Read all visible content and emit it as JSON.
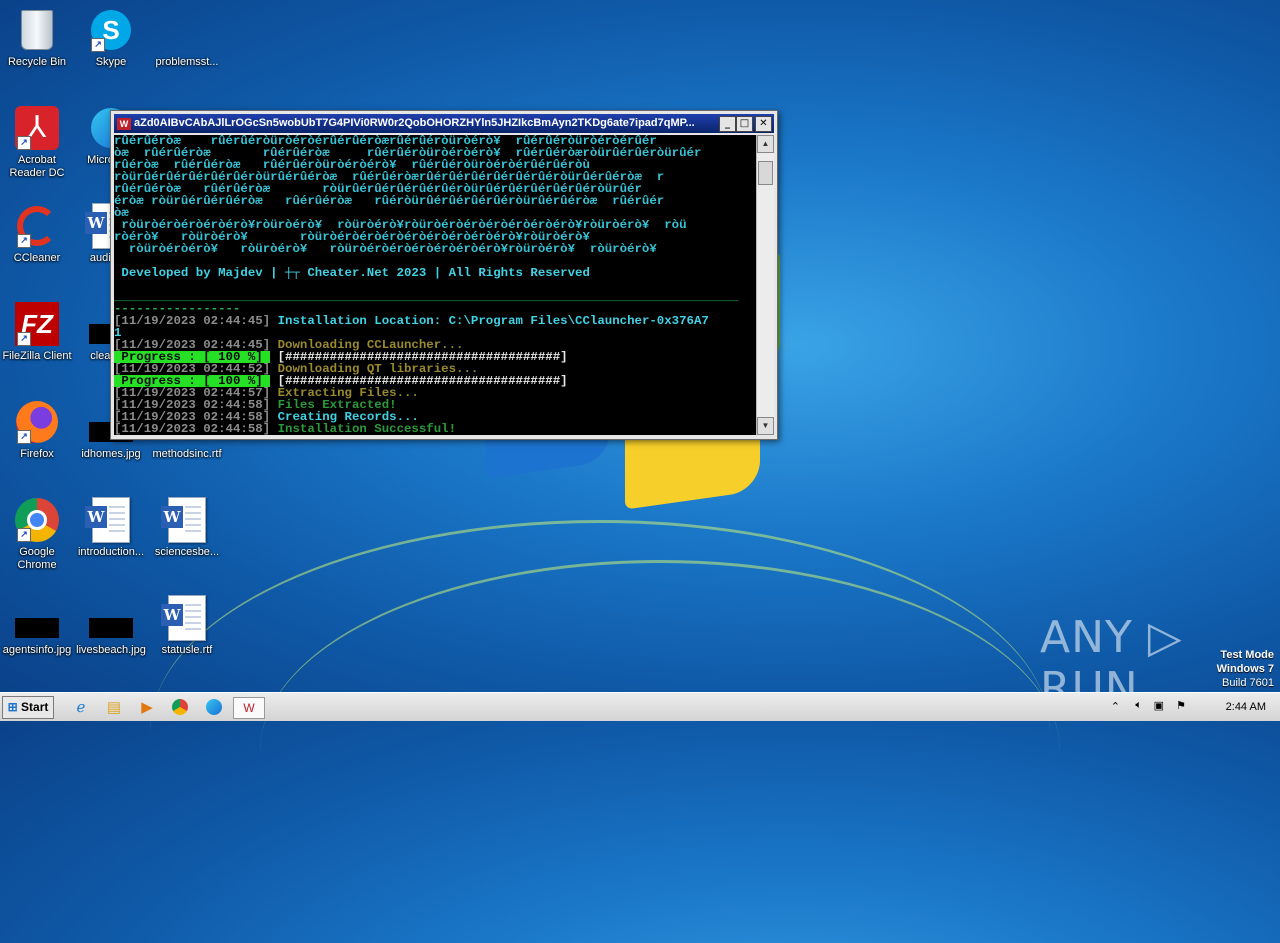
{
  "desktop": {
    "icons": [
      {
        "id": "recycle-bin",
        "label": "Recycle Bin",
        "icon": "recycle-bin-icon"
      },
      {
        "id": "skype",
        "label": "Skype",
        "icon": "skype-icon"
      },
      {
        "id": "problems",
        "label": "problemsst..."
      },
      {
        "id": "acrobat",
        "label": "Acrobat Reader DC"
      },
      {
        "id": "microsoft",
        "label": "Microso..."
      },
      {
        "id": "ccleaner",
        "label": "CCleaner"
      },
      {
        "id": "audiop",
        "label": "audiop..."
      },
      {
        "id": "filezilla",
        "label": "FileZilla Client"
      },
      {
        "id": "cleang",
        "label": "cleang..."
      },
      {
        "id": "firefox",
        "label": "Firefox"
      },
      {
        "id": "idhomes",
        "label": "idhomes.jpg"
      },
      {
        "id": "methodsinc",
        "label": "methodsinc.rtf"
      },
      {
        "id": "chrome",
        "label": "Google Chrome"
      },
      {
        "id": "introduction",
        "label": "introduction..."
      },
      {
        "id": "sciencesbe",
        "label": "sciencesbe..."
      },
      {
        "id": "agentsinfo",
        "label": "agentsinfo.jpg"
      },
      {
        "id": "livesbeach",
        "label": "livesbeach.jpg"
      },
      {
        "id": "statusle",
        "label": "statusle.rtf"
      }
    ]
  },
  "console_window": {
    "title": "aZd0AIBvCAbAJlLrOGcSn5wobUbT7G4PIVi0RW0r2QobOHORZHYln5JHZIkcBmAyn2TKDg6ate7ipad7qMP...",
    "minimize": "_",
    "maximize": "□",
    "close": "✕",
    "lines": [
      {
        "cls": "art",
        "text": "rûérûéròæ    rûérûéròüròéròérûérûéròærûérûéròüròérò¥  rûérûéròüròéròérûér"
      },
      {
        "cls": "art",
        "text": "òæ  rûérûéròæ       rûérûéròæ     rûérûéròüròéròérò¥  rûérûéròæròürûérûéròürûér"
      },
      {
        "cls": "art",
        "text": "rûéròæ  rûérûéròæ   rûérûéròüròéròérò¥  rûérûéròüròéròérûérûéròù"
      },
      {
        "cls": "art",
        "text": "ròürûérûérûérûérûéròürûérûéròæ  rûérûéròærûérûérûérûérûérûéròürûérûéròæ  r"
      },
      {
        "cls": "art",
        "text": "rûérûéròæ   rûérûéròæ       ròürûérûérûérûérûéròürûérûérûérûérûéròürûér"
      },
      {
        "cls": "art",
        "text": "éròæ ròürûérûérûéròæ   rûérûéròæ   rûéròürûérûérûérûéròürûérûéròæ  rûérûér"
      },
      {
        "cls": "art",
        "text": "òæ"
      },
      {
        "cls": "art",
        "text": " ròüròéròéròéròérò¥ròüròérò¥  ròüròérò¥ròüròéròéròéròéròéròérò¥ròüròérò¥  ròü"
      },
      {
        "cls": "art",
        "text": "ròérò¥   ròüròérò¥       ròüròéròéròéròéròéròéròéròérò¥ròüròérò¥"
      },
      {
        "cls": "art",
        "text": "  ròüròéròérò¥   ròüròérò¥   ròüròéròéròéròéròéròérò¥ròüròérò¥  ròüròérò¥"
      },
      {
        "cls": "art",
        "text": ""
      },
      {
        "cls": "cyan",
        "text": " Developed by Majdev | ┼┬ Cheater.Net 2023 | All Rights Reserved"
      },
      {
        "cls": "art",
        "text": ""
      },
      {
        "cls": "sep",
        "text": "____________________________________________________________________________________"
      },
      {
        "cls": "sep",
        "text": "-----------------"
      },
      {
        "cls": "mix",
        "parts": [
          {
            "cls": "gray",
            "text": "[11/19/2023 02:44:45] "
          },
          {
            "cls": "cyan",
            "text": "Installation Location: C:\\Program Files\\CClauncher-0x376A7"
          }
        ]
      },
      {
        "cls": "cyan",
        "text": "1"
      },
      {
        "cls": "mix",
        "parts": [
          {
            "cls": "gray",
            "text": "[11/19/2023 02:44:45] "
          },
          {
            "cls": "olive",
            "text": "Downloading CCLauncher..."
          }
        ]
      },
      {
        "cls": "mix",
        "parts": [
          {
            "cls": "pbar",
            "text": " Progress : [ 100 %] "
          },
          {
            "cls": "white",
            "text": " [#####################################]"
          }
        ]
      },
      {
        "cls": "mix",
        "parts": [
          {
            "cls": "gray",
            "text": "[11/19/2023 02:44:52] "
          },
          {
            "cls": "olive",
            "text": "Downloading QT libraries..."
          }
        ]
      },
      {
        "cls": "mix",
        "parts": [
          {
            "cls": "pbar",
            "text": " Progress : [ 100 %] "
          },
          {
            "cls": "white",
            "text": " [#####################################]"
          }
        ]
      },
      {
        "cls": "mix",
        "parts": [
          {
            "cls": "gray",
            "text": "[11/19/2023 02:44:57] "
          },
          {
            "cls": "olive",
            "text": "Extracting Files..."
          }
        ]
      },
      {
        "cls": "mix",
        "parts": [
          {
            "cls": "gray",
            "text": "[11/19/2023 02:44:58] "
          },
          {
            "cls": "dgreen",
            "text": "Files Extracted!"
          }
        ]
      },
      {
        "cls": "mix",
        "parts": [
          {
            "cls": "gray",
            "text": "[11/19/2023 02:44:58] "
          },
          {
            "cls": "cyan",
            "text": "Creating Records..."
          }
        ]
      },
      {
        "cls": "mix",
        "parts": [
          {
            "cls": "gray",
            "text": "[11/19/2023 02:44:58] "
          },
          {
            "cls": "dgreen",
            "text": "Installation Successful!"
          }
        ]
      }
    ]
  },
  "taskbar": {
    "start_label": "Start",
    "clock": "2:44 AM"
  },
  "watermark": {
    "text": "ANY ▷ RUN"
  },
  "testmode": {
    "line1": "Test Mode",
    "line2": "Windows 7",
    "line3": "Build 7601"
  },
  "colors": {
    "console_bg": "#000000",
    "title_bar": "#0a246a",
    "progress": "#25e025"
  }
}
